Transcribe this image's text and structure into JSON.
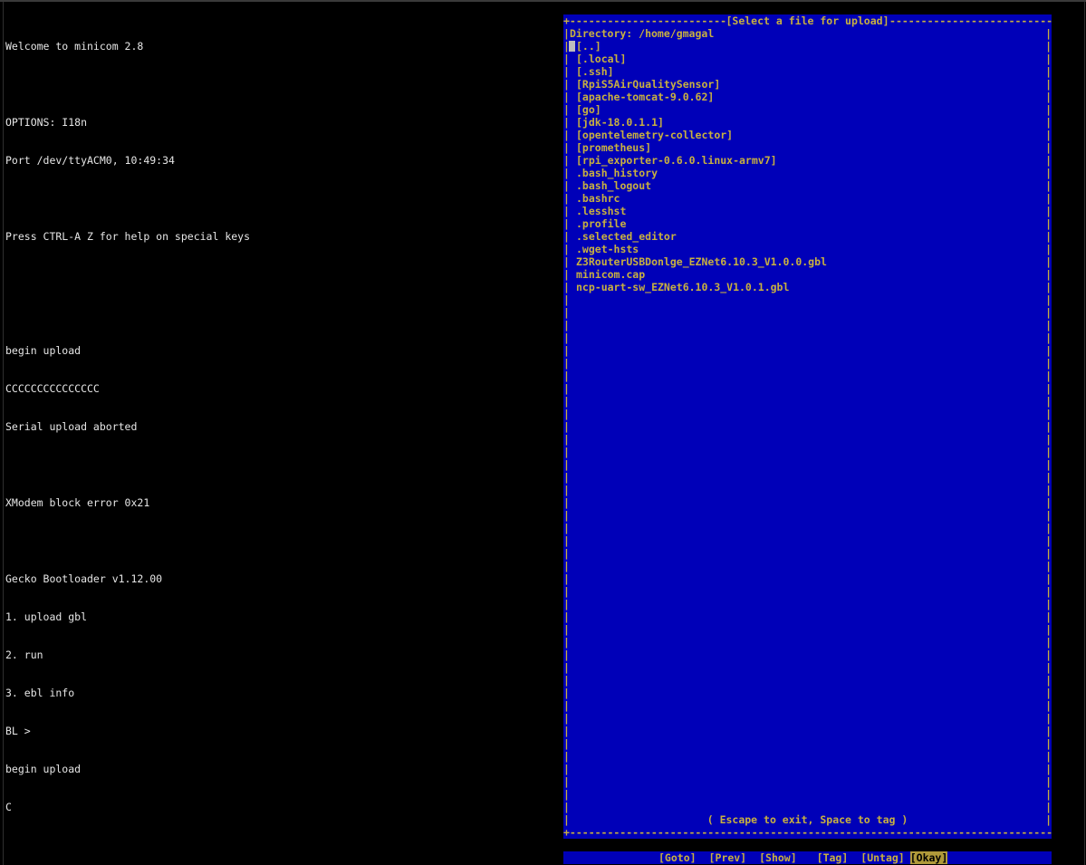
{
  "terminal": {
    "lines": [
      "Welcome to minicom 2.8",
      "",
      "OPTIONS: I18n",
      "Port /dev/ttyACM0, 10:49:34",
      "",
      "Press CTRL-A Z for help on special keys",
      "",
      "",
      "begin upload",
      "CCCCCCCCCCCCCCC",
      "Serial upload aborted",
      "",
      "XModem block error 0x21",
      "",
      "Gecko Bootloader v1.12.00",
      "1. upload gbl",
      "2. run",
      "3. ebl info",
      "BL >",
      "begin upload",
      "C"
    ]
  },
  "dialog": {
    "title": "[Select a file for upload]",
    "directory_label": "Directory: /home/gmagal",
    "files": [
      "[..]",
      "[.local]",
      "[.ssh]",
      "[RpiS5AirQualitySensor]",
      "[apache-tomcat-9.0.62]",
      "[go]",
      "[jdk-18.0.1.1]",
      "[opentelemetry-collector]",
      "[prometheus]",
      "[rpi_exporter-0.6.0.linux-armv7]",
      ".bash_history",
      ".bash_logout",
      ".bashrc",
      ".lesshst",
      ".profile",
      ".selected_editor",
      ".wget-hsts",
      "Z3RouterUSBDonlge_EZNet6.10.3_V1.0.0.gbl",
      "minicom.cap",
      "ncp-uart-sw_EZNet6.10.3_V1.0.1.gbl"
    ],
    "hint": "( Escape to exit, Space to tag )"
  },
  "buttons": {
    "goto": "[Goto]",
    "prev": "[Prev]",
    "show": "[Show]",
    "tag": "[Tag]",
    "untag": "[Untag]",
    "okay": "[Okay]"
  },
  "colors": {
    "terminal_bg": "#000000",
    "terminal_fg": "#e6e6e6",
    "dialog_bg": "#0000b8",
    "dialog_fg": "#c8b040",
    "active_button_bg": "#b09a3a"
  }
}
